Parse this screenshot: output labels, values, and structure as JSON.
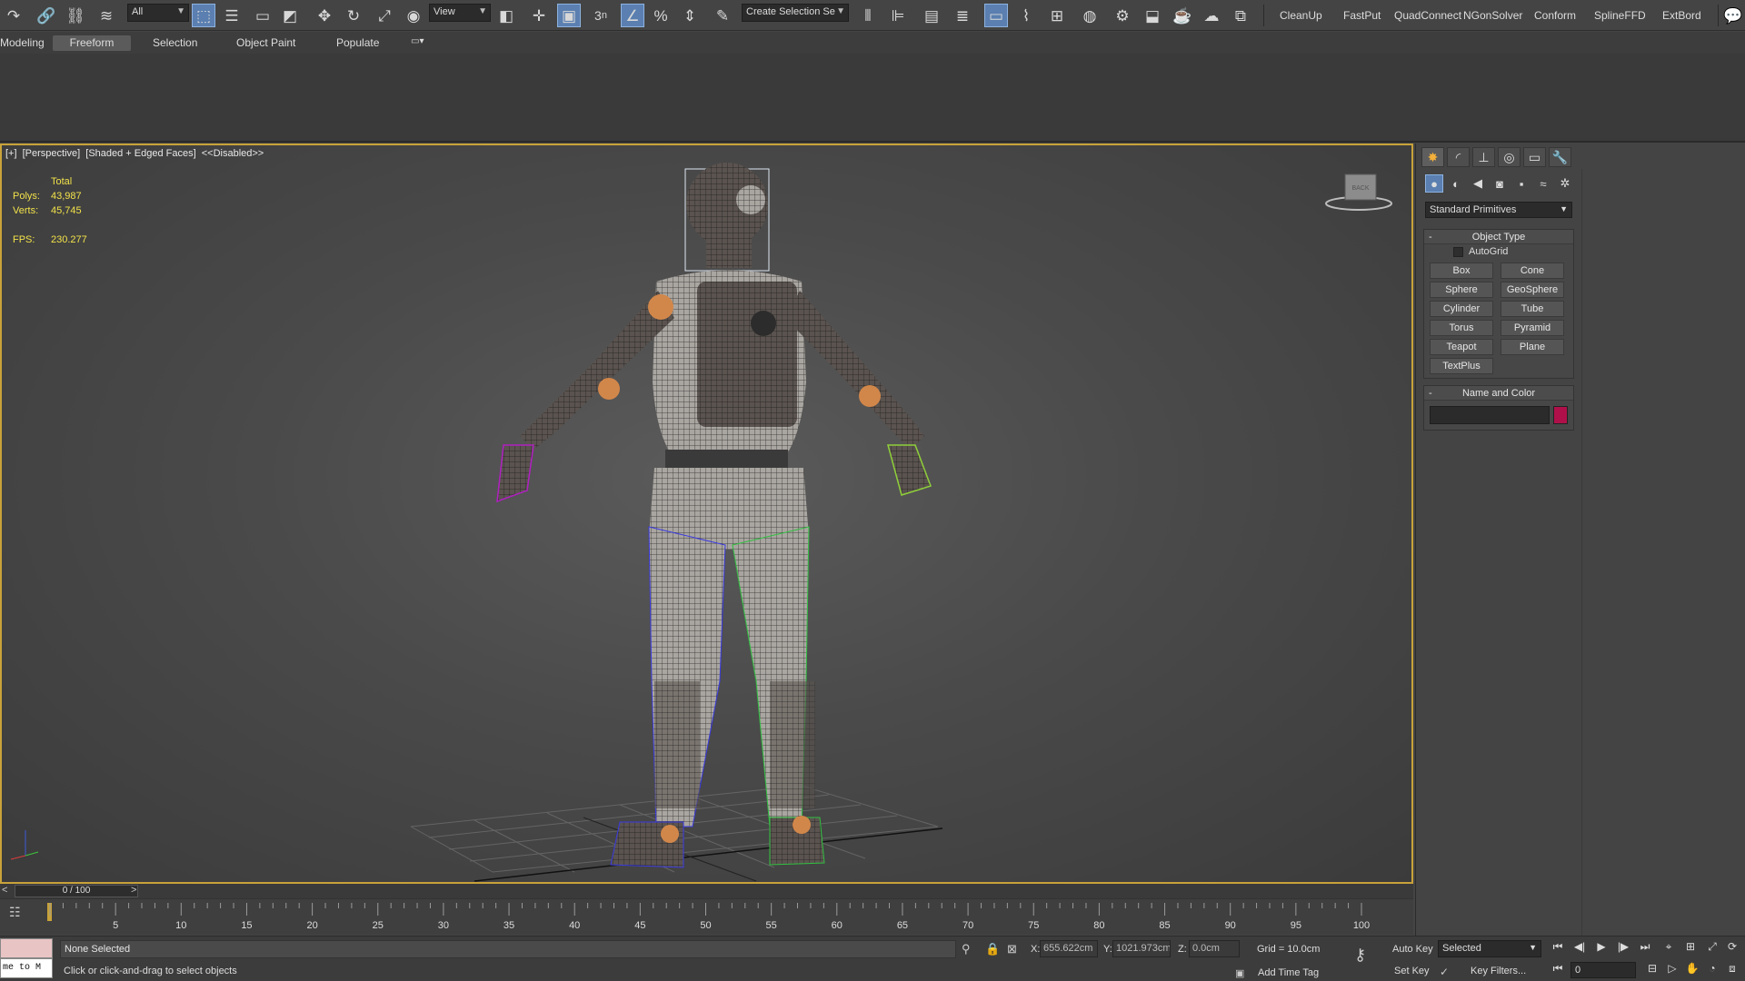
{
  "toolbar": {
    "selection_filter": "All",
    "ref_coord": "View",
    "named_selection_placeholder": "Create Selection Se",
    "snap_toggle_label": "3",
    "plugins": [
      "CleanUp",
      "FastPut",
      "QuadConnect",
      "NGonSolver",
      "Conform",
      "SplineFFD",
      "ExtBord"
    ]
  },
  "ribbon": {
    "tabs": [
      "Modeling",
      "Freeform",
      "Selection",
      "Object Paint",
      "Populate"
    ],
    "active_tab": "Freeform"
  },
  "viewport": {
    "label_parts": [
      "[+]",
      "[Perspective]",
      "[Shaded + Edged Faces]",
      "<<Disabled>>"
    ],
    "stats": {
      "header": "Total",
      "polys_label": "Polys:",
      "polys": "43,987",
      "verts_label": "Verts:",
      "verts": "45,745",
      "fps_label": "FPS:",
      "fps": "230.277"
    },
    "viewcube_label": "BACK",
    "border_color": "#c8a23a",
    "stats_color": "#f2e24a"
  },
  "command_panel": {
    "primitive_type": "Standard Primitives",
    "object_type_title": "Object Type",
    "autogrid_label": "AutoGrid",
    "buttons": [
      "Box",
      "Cone",
      "Sphere",
      "GeoSphere",
      "Cylinder",
      "Tube",
      "Torus",
      "Pyramid",
      "Teapot",
      "Plane",
      "TextPlus"
    ],
    "name_color_title": "Name and Color",
    "object_color": "#b0104a"
  },
  "timeline": {
    "position": "0 / 100",
    "prev": "<",
    "next": ">",
    "ticks": [
      "5",
      "10",
      "15",
      "20",
      "25",
      "30",
      "35",
      "40",
      "45",
      "50",
      "55",
      "60",
      "65",
      "70",
      "75",
      "80",
      "85",
      "90",
      "95",
      "100"
    ]
  },
  "status": {
    "maxscript_text": "me to M",
    "selection": "None Selected",
    "prompt": "Click or click-and-drag to select objects",
    "x_label": "X:",
    "x": "655.622cm",
    "y_label": "Y:",
    "y": "1021.973cm",
    "z_label": "Z:",
    "z": "0.0cm",
    "grid": "Grid = 10.0cm",
    "add_time_tag": "Add Time Tag",
    "auto_key": "Auto Key",
    "set_key": "Set Key",
    "key_mode": "Selected",
    "key_filters": "Key Filters...",
    "current_frame": "0"
  }
}
